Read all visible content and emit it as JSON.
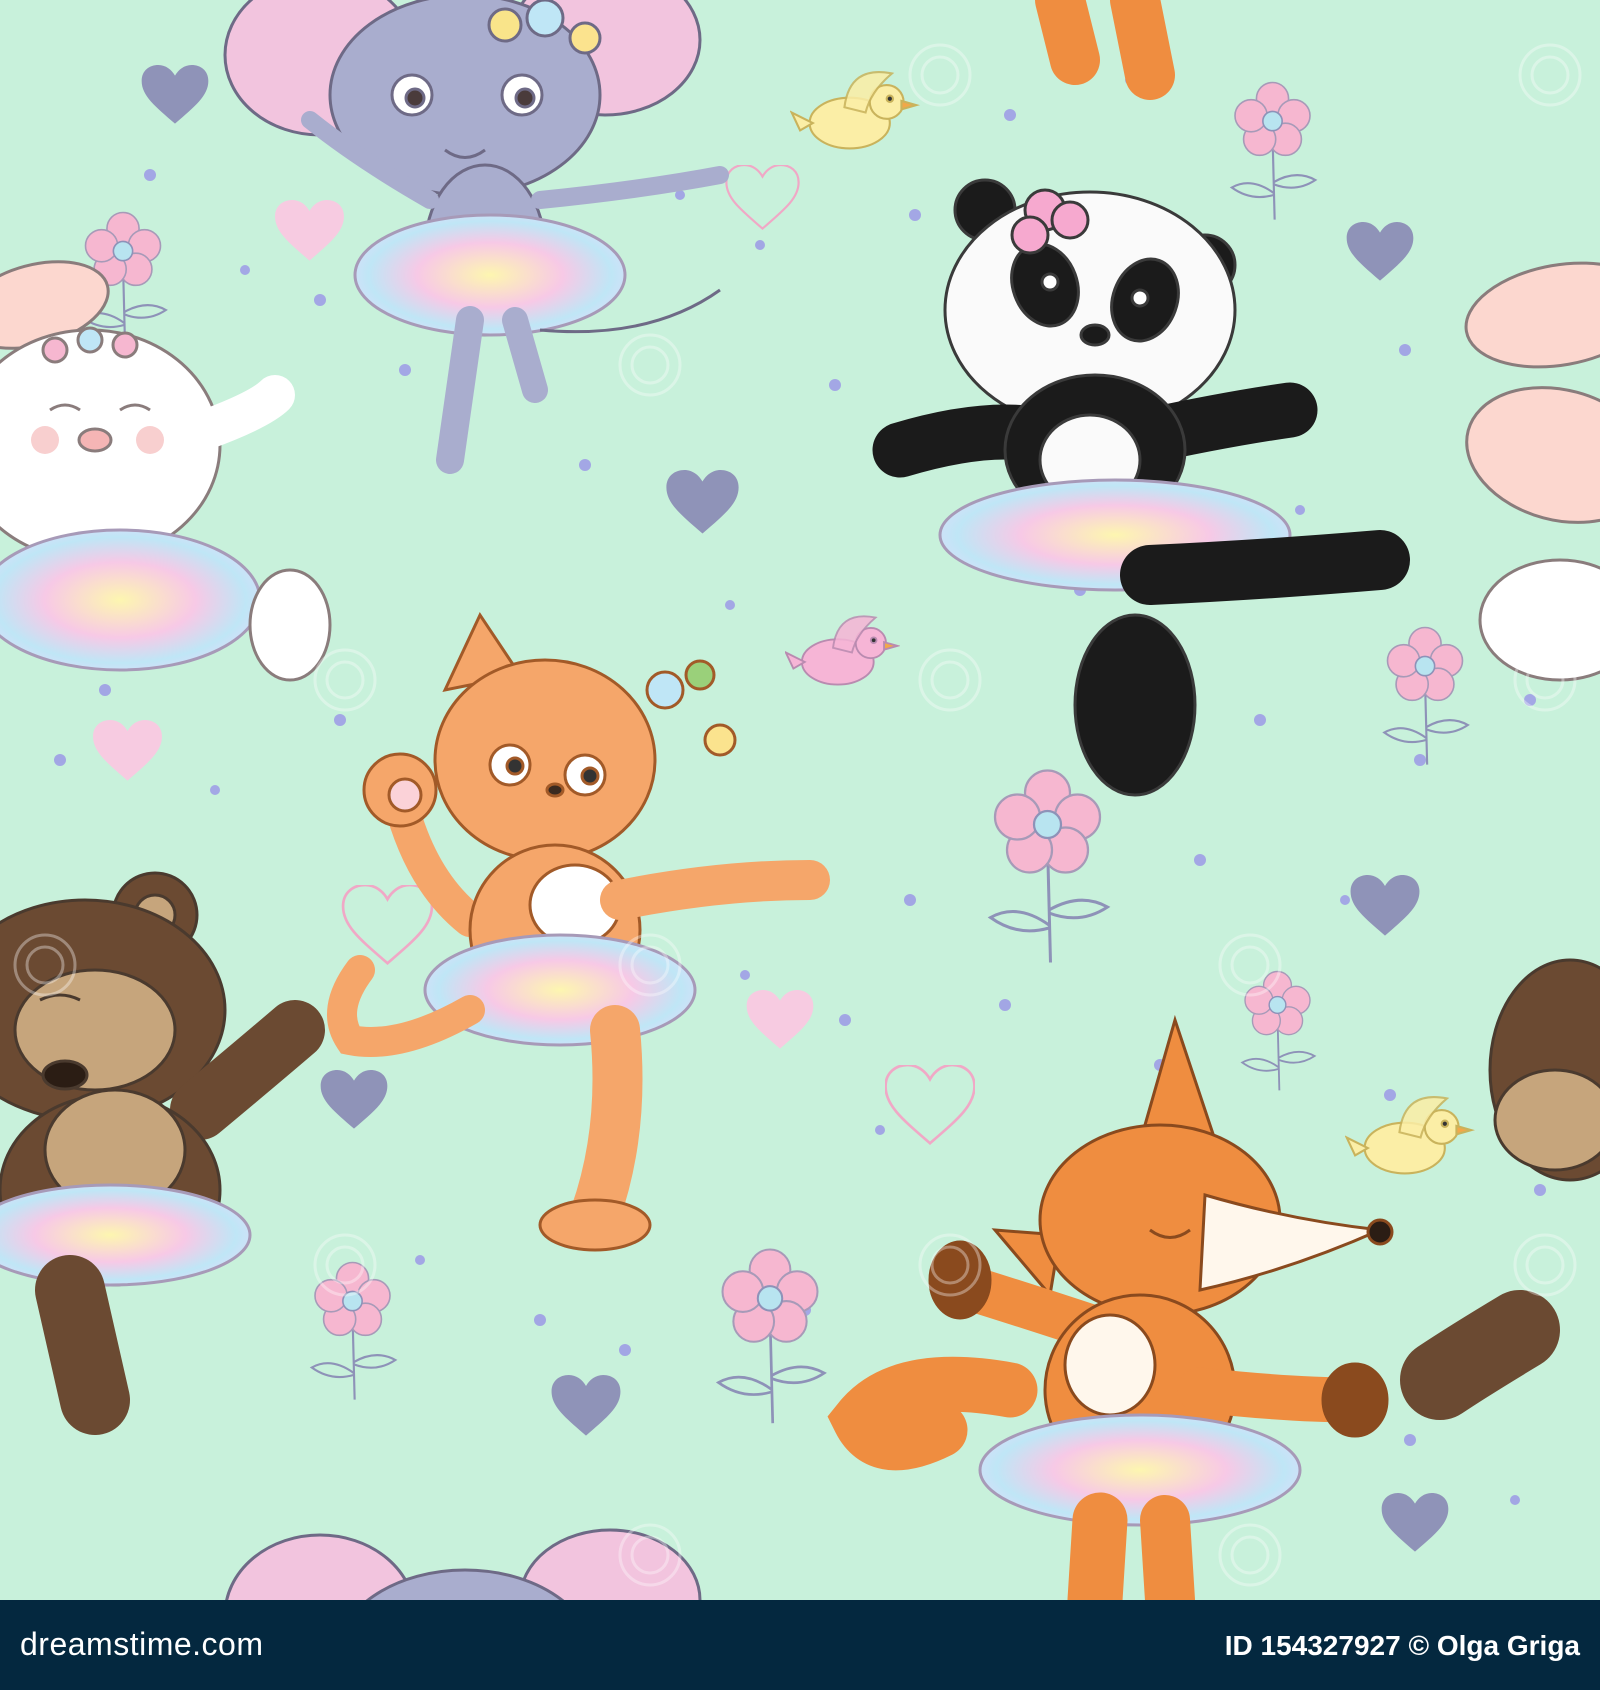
{
  "image": {
    "subject": "seamless pattern of cartoon animal ballerinas in tutus",
    "background_color": "#c8f1db",
    "animals": [
      "mouse",
      "panda",
      "bunny",
      "cat",
      "bear",
      "fox"
    ],
    "watermark_text": "dreamstime"
  },
  "footer": {
    "brand": "dreamstime.com",
    "credit": "ID 154327927 © Olga Griga"
  },
  "colors": {
    "footer_bg": "#04283f",
    "heart_blue": "#8f93b8",
    "heart_pink": "#f7cbe1",
    "dot": "#9c9ae6"
  }
}
